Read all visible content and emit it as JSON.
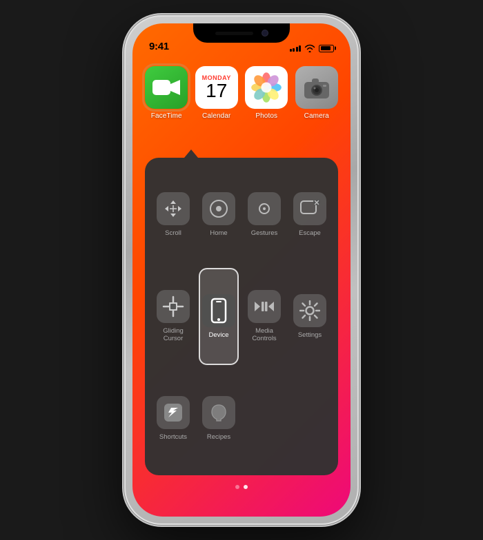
{
  "phone": {
    "status_bar": {
      "time": "9:41",
      "signal_bars": [
        4,
        5,
        7,
        9,
        11
      ],
      "battery_label": "Battery"
    },
    "home_screen": {
      "apps": [
        {
          "id": "facetime",
          "label": "FaceTime",
          "selected": true
        },
        {
          "id": "calendar",
          "label": "Calendar",
          "month": "Monday",
          "day": "17"
        },
        {
          "id": "photos",
          "label": "Photos"
        },
        {
          "id": "camera",
          "label": "Camera"
        }
      ]
    },
    "assistive_panel": {
      "items": [
        {
          "id": "scroll",
          "label": "Scroll",
          "active": false
        },
        {
          "id": "home",
          "label": "Home",
          "active": false
        },
        {
          "id": "gestures",
          "label": "Gestures",
          "active": false
        },
        {
          "id": "escape",
          "label": "Escape",
          "active": false
        },
        {
          "id": "gliding-cursor",
          "label": "Gliding\nCursor",
          "active": false
        },
        {
          "id": "device",
          "label": "Device",
          "active": true
        },
        {
          "id": "media-controls",
          "label": "Media\nControls",
          "active": false
        },
        {
          "id": "settings",
          "label": "Settings",
          "active": false
        },
        {
          "id": "shortcuts",
          "label": "Shortcuts",
          "active": false
        },
        {
          "id": "recipes",
          "label": "Recipes",
          "active": false
        }
      ]
    },
    "page_dots": [
      {
        "active": false
      },
      {
        "active": true
      }
    ]
  }
}
